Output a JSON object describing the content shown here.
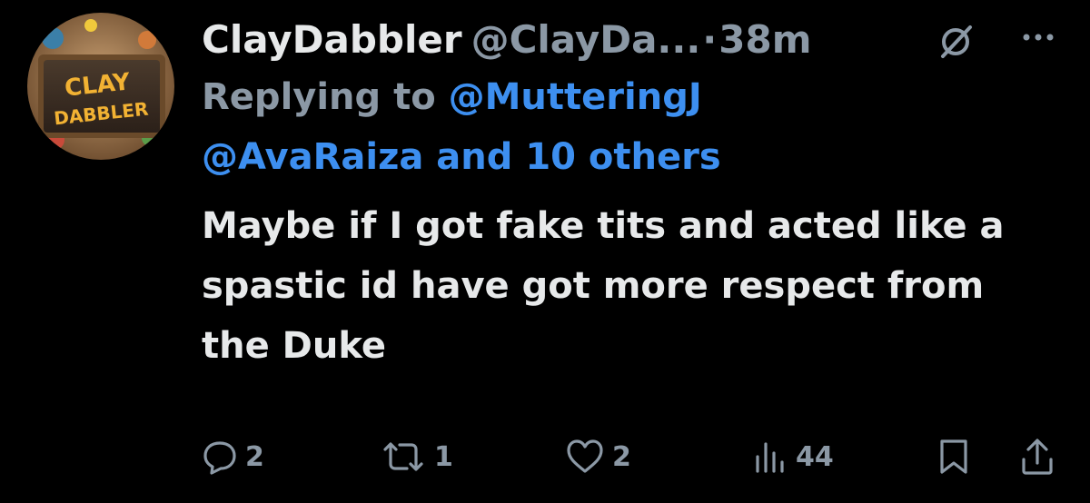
{
  "tweet": {
    "author": {
      "display_name": "ClayDabbler",
      "handle": "@ClayDa...",
      "avatar_text_line1": "CLAY",
      "avatar_text_line2": "DABBLER"
    },
    "separator": "·",
    "time": "38m",
    "reply": {
      "prefix": "Replying to ",
      "mention_1": "@MutteringJ",
      "others": "@AvaRaiza and 10 others"
    },
    "text": "Maybe if I got fake tits and acted like a spastic id have got more respect from the Duke"
  },
  "actions": {
    "replies": "2",
    "reposts": "1",
    "likes": "2",
    "views": "44"
  },
  "icons": {
    "header": [
      "grok-icon",
      "more-icon"
    ],
    "actions": [
      "reply-icon",
      "repost-icon",
      "like-icon",
      "views-icon",
      "bookmark-icon",
      "share-icon"
    ]
  },
  "colors": {
    "background": "#000000",
    "text_primary": "#e7e9ea",
    "text_secondary": "#8b98a5",
    "accent": "#3d8ff0"
  }
}
